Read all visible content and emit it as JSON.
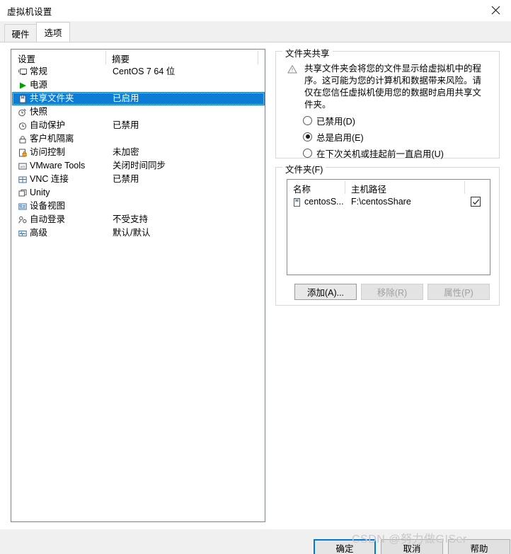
{
  "window": {
    "title": "虚拟机设置",
    "close_icon": "close-icon"
  },
  "tabs": [
    {
      "label": "硬件",
      "active": false
    },
    {
      "label": "选项",
      "active": true
    }
  ],
  "settings_list": {
    "headers": {
      "name": "设置",
      "summary": "摘要"
    },
    "rows": [
      {
        "icon": "monitor-icon",
        "label": "常规",
        "summary": "CentOS 7 64 位",
        "selected": false
      },
      {
        "icon": "play-icon",
        "label": "电源",
        "summary": "",
        "selected": false
      },
      {
        "icon": "folder-icon",
        "label": "共享文件夹",
        "summary": "已启用",
        "selected": true
      },
      {
        "icon": "snapshot-icon",
        "label": "快照",
        "summary": "",
        "selected": false
      },
      {
        "icon": "autoprotect-icon",
        "label": "自动保护",
        "summary": "已禁用",
        "selected": false
      },
      {
        "icon": "lock-icon",
        "label": "客户机隔离",
        "summary": "",
        "selected": false
      },
      {
        "icon": "access-control-icon",
        "label": "访问控制",
        "summary": "未加密",
        "selected": false
      },
      {
        "icon": "vmware-tools-icon",
        "label": "VMware Tools",
        "summary": "关闭时间同步",
        "selected": false
      },
      {
        "icon": "vnc-icon",
        "label": "VNC 连接",
        "summary": "已禁用",
        "selected": false
      },
      {
        "icon": "unity-icon",
        "label": "Unity",
        "summary": "",
        "selected": false
      },
      {
        "icon": "device-view-icon",
        "label": "设备视图",
        "summary": "",
        "selected": false
      },
      {
        "icon": "auto-login-icon",
        "label": "自动登录",
        "summary": "不受支持",
        "selected": false
      },
      {
        "icon": "advanced-icon",
        "label": "高级",
        "summary": "默认/默认",
        "selected": false
      }
    ]
  },
  "folder_sharing": {
    "group_title": "文件夹共享",
    "warning_icon": "warning-triangle-icon",
    "warning_text": "共享文件夹会将您的文件显示给虚拟机中的程序。这可能为您的计算机和数据带来风险。请仅在您信任虚拟机使用您的数据时启用共享文件夹。",
    "options": [
      {
        "label": "已禁用(D)",
        "checked": false
      },
      {
        "label": "总是启用(E)",
        "checked": true
      },
      {
        "label": "在下次关机或挂起前一直启用(U)",
        "checked": false
      }
    ]
  },
  "folders": {
    "group_title": "文件夹(F)",
    "headers": {
      "name": "名称",
      "path": "主机路径"
    },
    "rows": [
      {
        "icon": "folder-icon",
        "name": "centosS...",
        "path": "F:\\centosShare",
        "enabled": true
      }
    ],
    "buttons": [
      {
        "label": "添加(A)...",
        "disabled": false
      },
      {
        "label": "移除(R)",
        "disabled": true
      },
      {
        "label": "属性(P)",
        "disabled": true
      }
    ]
  },
  "footer": {
    "ok": "确定",
    "cancel": "取消",
    "help": "帮助"
  },
  "watermark": "CSDN @努力做GISer",
  "colors": {
    "selection_blue": "#0c7cd5",
    "focus_blue": "#0078d7",
    "play_green": "#00a200",
    "accent_orange": "#e8820c"
  }
}
